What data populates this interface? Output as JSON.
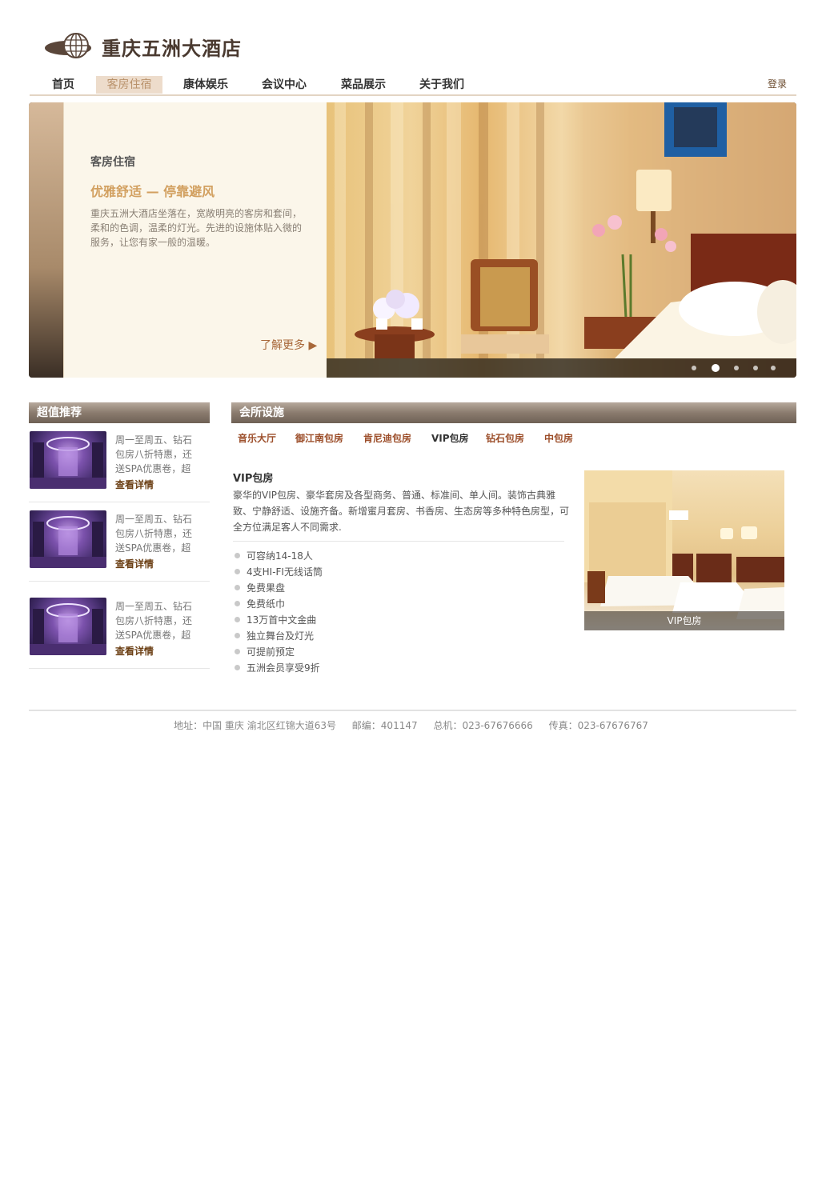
{
  "header": {
    "site_title": "重庆五洲大酒店",
    "login": "登录"
  },
  "nav": {
    "items": [
      "首页",
      "客房住宿",
      "康体娱乐",
      "会议中心",
      "菜品展示",
      "关于我们"
    ],
    "active_index": 1
  },
  "banner": {
    "category": "客房住宿",
    "slogan": "优雅舒适 — 停靠避风",
    "description": "重庆五洲大酒店坐落在，宽敞明亮的客房和套间，柔和的色调，温柔的灯光。先进的设施体贴入微的服务，让您有家一般的温暖。",
    "more_link": "了解更多 ▶",
    "slide_count": 5,
    "active_slide": 2
  },
  "sidebar": {
    "title": "超值推荐",
    "items": [
      {
        "text": "周一至周五、钻石包房八折特惠，还送SPA优惠卷，超",
        "link": "查看详情"
      },
      {
        "text": "周一至周五、钻石包房八折特惠，还送SPA优惠卷，超",
        "link": "查看详情"
      },
      {
        "text": "周一至周五、钻石包房八折特惠，还送SPA优惠卷，超",
        "link": "查看详情"
      }
    ]
  },
  "facilities": {
    "title": "会所设施",
    "tabs": [
      "音乐大厅",
      "御江南包房",
      "肯尼迪包房",
      "VIP包房",
      "钻石包房",
      "中包房"
    ],
    "selected_tab": 3,
    "room": {
      "name": "VIP包房",
      "description": "豪华的VIP包房、豪华套房及各型商务、普通、标准间、单人间。装饰古典雅致、宁静舒适、设施齐备。新增蜜月套房、书香房、生态房等多种特色房型，可全方位满足客人不同需求.",
      "features": [
        "可容纳14-18人",
        "4支HI-FI无线话筒",
        "免费果盘",
        "免费纸巾",
        "13万首中文金曲",
        "独立舞台及灯光",
        "可提前预定",
        "五洲会员享受9折"
      ],
      "image_caption": "VIP包房"
    }
  },
  "footer": {
    "address": "地址：中国 重庆 渝北区红锦大道63号",
    "zip": "邮编：401147",
    "phone": "总机：023-67676666",
    "fax": "传真：023-67676767"
  },
  "colors": {
    "accent_brown": "#6b4b2e",
    "active_nav_bg": "#eddccb",
    "slogan_gold": "#d2a060"
  }
}
